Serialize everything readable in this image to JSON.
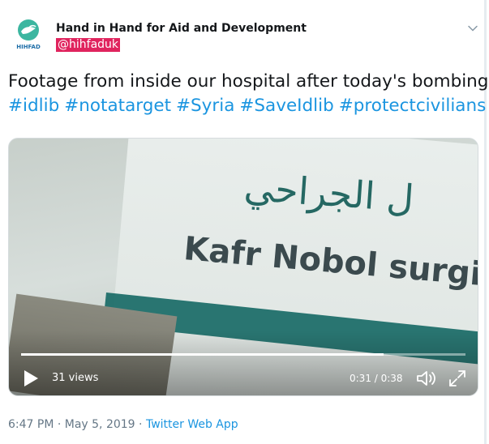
{
  "author": {
    "name": "Hand in Hand for Aid and Development",
    "handle": "@hihfaduk",
    "avatar_text": "HIHFAD"
  },
  "tweet": {
    "text_line1": "Footage from inside our hospital after today's bombing",
    "hashtags": [
      "#idlib",
      "#notatarget",
      "#Syria",
      "#SaveIdlib",
      "#protectcivilians"
    ]
  },
  "video": {
    "sign_arabic": "ل الجراحي",
    "sign_english": "Kafr Nobol surgic",
    "views": "31 views",
    "time": "0:31 / 0:38",
    "progress": 0.815
  },
  "meta": {
    "timestamp": "6:47 PM · May 5, 2019 · ",
    "source": "Twitter Web App"
  },
  "colors": {
    "link": "#1b95e0",
    "brand": "#3cb6a0",
    "handle_highlight": "#e0245e"
  },
  "icons": [
    "avatar-logo-icon",
    "chevron-down-icon",
    "play-icon",
    "volume-icon",
    "fullscreen-icon"
  ]
}
